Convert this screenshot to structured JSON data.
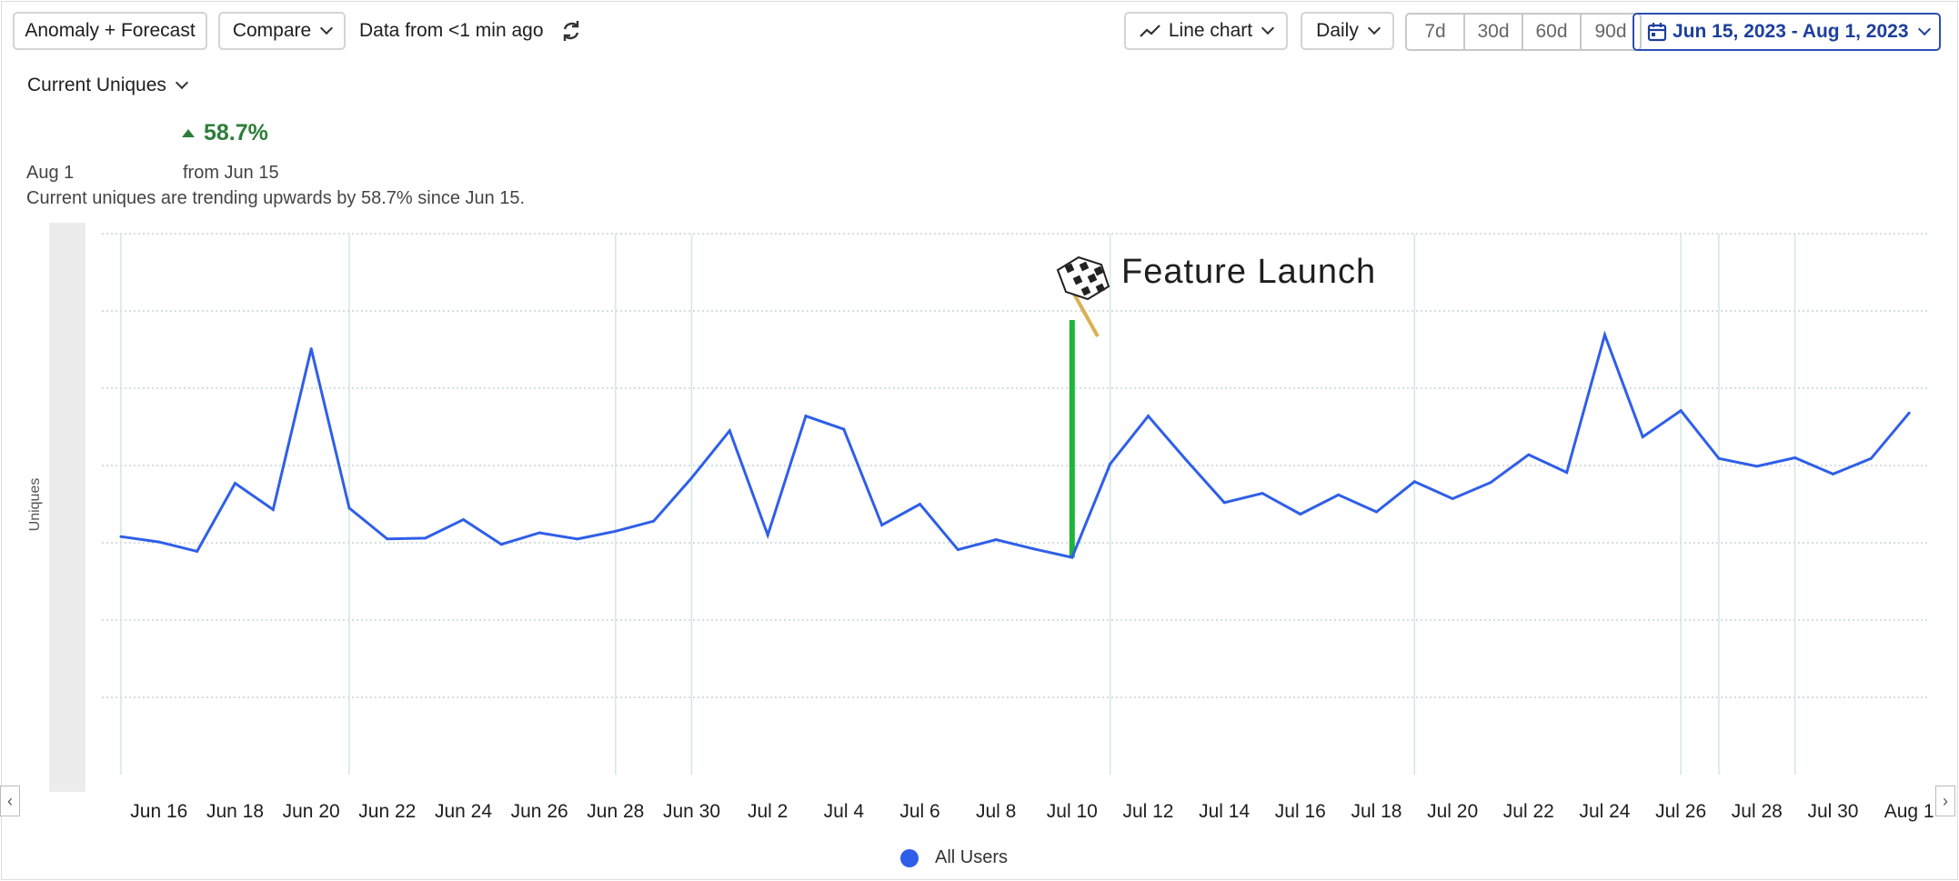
{
  "toolbar": {
    "anomaly_label": "Anomaly + Forecast",
    "compare_label": "Compare",
    "data_freshness": "Data from <1 min ago",
    "chart_type_label": "Line chart",
    "interval_label": "Daily",
    "ranges": [
      "7d",
      "30d",
      "60d",
      "90d"
    ],
    "date_range_label": "Jun 15, 2023 - Aug 1, 2023"
  },
  "metric": {
    "selector_label": "Current Uniques",
    "change_pct": "58.7%",
    "date_label": "Aug 1",
    "from_label": "from Jun 15",
    "summary": "Current uniques are trending upwards by 58.7% since Jun 15."
  },
  "annotation": {
    "label": "Feature Launch",
    "date": "Jul 10",
    "color": "#1db53a"
  },
  "chart_data": {
    "type": "line",
    "ylabel": "Uniques",
    "xlabel": "",
    "title": "",
    "x_tick_labels": [
      "Jun 16",
      "Jun 18",
      "Jun 20",
      "Jun 22",
      "Jun 24",
      "Jun 26",
      "Jun 28",
      "Jun 30",
      "Jul 2",
      "Jul 4",
      "Jul 6",
      "Jul 8",
      "Jul 10",
      "Jul 12",
      "Jul 14",
      "Jul 16",
      "Jul 18",
      "Jul 20",
      "Jul 22",
      "Jul 24",
      "Jul 26",
      "Jul 28",
      "Jul 30",
      "Aug 1"
    ],
    "x": [
      "Jun 15",
      "Jun 16",
      "Jun 17",
      "Jun 18",
      "Jun 19",
      "Jun 20",
      "Jun 21",
      "Jun 22",
      "Jun 23",
      "Jun 24",
      "Jun 25",
      "Jun 26",
      "Jun 27",
      "Jun 28",
      "Jun 29",
      "Jun 30",
      "Jul 1",
      "Jul 2",
      "Jul 3",
      "Jul 4",
      "Jul 5",
      "Jul 6",
      "Jul 7",
      "Jul 8",
      "Jul 9",
      "Jul 10",
      "Jul 11",
      "Jul 12",
      "Jul 13",
      "Jul 14",
      "Jul 15",
      "Jul 16",
      "Jul 17",
      "Jul 18",
      "Jul 19",
      "Jul 20",
      "Jul 21",
      "Jul 22",
      "Jul 23",
      "Jul 24",
      "Jul 25",
      "Jul 26",
      "Jul 27",
      "Jul 28",
      "Jul 29",
      "Jul 30",
      "Jul 31",
      "Aug 1"
    ],
    "series": [
      {
        "name": "All Users",
        "color": "#2f5fe8",
        "values": [
          3.08,
          3.01,
          2.89,
          3.77,
          3.43,
          5.51,
          3.45,
          3.05,
          3.06,
          3.3,
          2.98,
          3.13,
          3.05,
          3.15,
          3.28,
          3.84,
          4.45,
          3.1,
          4.64,
          4.47,
          3.23,
          3.5,
          2.91,
          3.04,
          2.92,
          2.81,
          4.02,
          4.64,
          4.07,
          3.52,
          3.64,
          3.37,
          3.62,
          3.4,
          3.79,
          3.57,
          3.78,
          4.14,
          3.91,
          5.69,
          4.37,
          4.71,
          4.09,
          3.99,
          4.1,
          3.89,
          4.09,
          4.68
        ]
      }
    ],
    "ylim": [
      0,
      7
    ],
    "y_tick_labels_visible": false,
    "grid": true,
    "legend_position": "bottom"
  }
}
